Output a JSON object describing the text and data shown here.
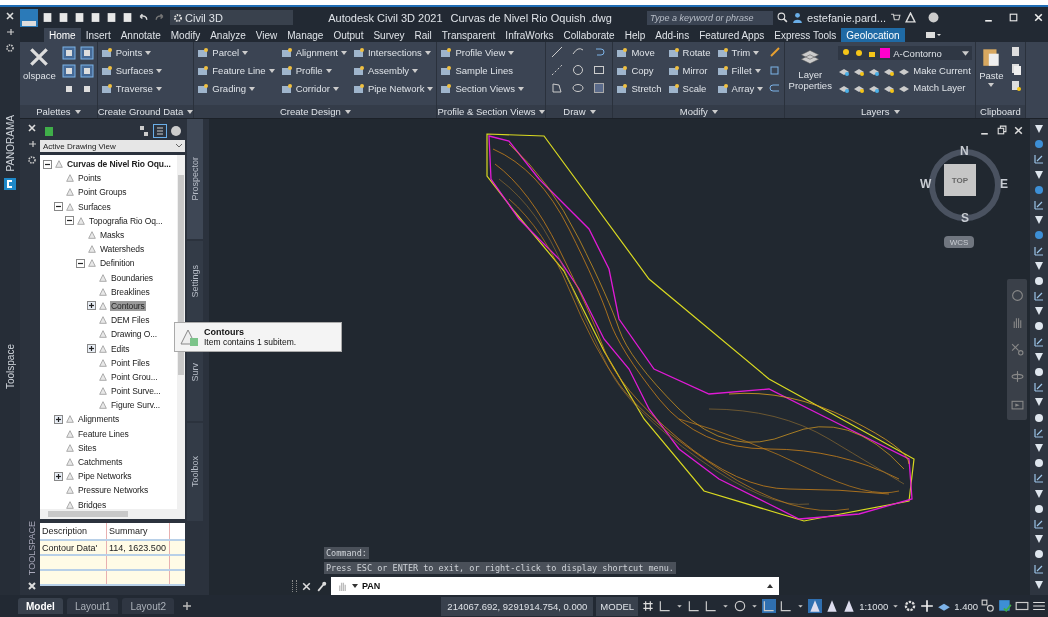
{
  "title_bar": {
    "workspace": "Civil 3D",
    "app_title": "Autodesk Civil 3D 2021",
    "file_name": "Curvas de Nivel Rio Oquish .dwg",
    "search_placeholder": "Type a keyword or phrase",
    "user": "estefanie.pard..."
  },
  "ribbon_tabs": [
    {
      "label": "Home",
      "selected": true,
      "kind": "standard"
    },
    {
      "label": "Insert",
      "selected": false,
      "kind": "standard"
    },
    {
      "label": "Annotate",
      "selected": false,
      "kind": "standard"
    },
    {
      "label": "Modify",
      "selected": false,
      "kind": "standard"
    },
    {
      "label": "Analyze",
      "selected": false,
      "kind": "standard"
    },
    {
      "label": "View",
      "selected": false,
      "kind": "standard"
    },
    {
      "label": "Manage",
      "selected": false,
      "kind": "standard"
    },
    {
      "label": "Output",
      "selected": false,
      "kind": "standard"
    },
    {
      "label": "Survey",
      "selected": false,
      "kind": "standard"
    },
    {
      "label": "Rail",
      "selected": false,
      "kind": "standard"
    },
    {
      "label": "Transparent",
      "selected": false,
      "kind": "standard"
    },
    {
      "label": "InfraWorks",
      "selected": false,
      "kind": "standard"
    },
    {
      "label": "Collaborate",
      "selected": false,
      "kind": "standard"
    },
    {
      "label": "Help",
      "selected": false,
      "kind": "standard"
    },
    {
      "label": "Add-ins",
      "selected": false,
      "kind": "standard"
    },
    {
      "label": "Featured Apps",
      "selected": false,
      "kind": "standard"
    },
    {
      "label": "Express Tools",
      "selected": false,
      "kind": "standard"
    },
    {
      "label": "Geolocation",
      "selected": false,
      "kind": "contextual"
    }
  ],
  "ribbon_panels": [
    {
      "title": "Palettes",
      "kind": "palettes",
      "big_button": "olspace"
    },
    {
      "title": "Create Ground Data",
      "kind": "tools",
      "columns": [
        [
          {
            "label": "Points",
            "dropdown": true
          },
          {
            "label": "Surfaces",
            "dropdown": true
          },
          {
            "label": "Traverse",
            "dropdown": true
          }
        ]
      ]
    },
    {
      "title": "Create Design",
      "kind": "tools",
      "columns": [
        [
          {
            "label": "Parcel",
            "dropdown": true
          },
          {
            "label": "Feature Line",
            "dropdown": true
          },
          {
            "label": "Grading",
            "dropdown": true
          }
        ],
        [
          {
            "label": "Alignment",
            "dropdown": true
          },
          {
            "label": "Profile",
            "dropdown": true
          },
          {
            "label": "Corridor",
            "dropdown": true
          }
        ],
        [
          {
            "label": "Intersections",
            "dropdown": true
          },
          {
            "label": "Assembly",
            "dropdown": true
          },
          {
            "label": "Pipe Network",
            "dropdown": true
          }
        ]
      ]
    },
    {
      "title": "Profile & Section Views",
      "kind": "tools",
      "columns": [
        [
          {
            "label": "Profile View",
            "dropdown": true
          },
          {
            "label": "Sample Lines",
            "dropdown": false
          },
          {
            "label": "Section Views",
            "dropdown": true
          }
        ]
      ]
    },
    {
      "title": "Draw",
      "kind": "draw"
    },
    {
      "title": "Modify",
      "kind": "tools",
      "columns": [
        [
          {
            "label": "Move",
            "dropdown": false
          },
          {
            "label": "Copy",
            "dropdown": false
          },
          {
            "label": "Stretch",
            "dropdown": false
          }
        ],
        [
          {
            "label": "Rotate",
            "dropdown": false
          },
          {
            "label": "Mirror",
            "dropdown": false
          },
          {
            "label": "Scale",
            "dropdown": false
          }
        ],
        [
          {
            "label": "Trim",
            "dropdown": true
          },
          {
            "label": "Fillet",
            "dropdown": true
          },
          {
            "label": "Array",
            "dropdown": true
          }
        ]
      ]
    },
    {
      "title": "Layers",
      "kind": "layers",
      "big_button": "Layer Properties",
      "layer": {
        "name": "A-Contorno",
        "color": "#ff00cc"
      },
      "actions": [
        "Make Current",
        "Match Layer"
      ]
    },
    {
      "title": "Clipboard",
      "kind": "clipboard",
      "big_button": "Paste"
    }
  ],
  "side_strip": {
    "top_label": "PANORAMA",
    "bottom_label": "Toolspace"
  },
  "toolspace": {
    "view": "Active Drawing View",
    "label": "TOOLSPACE",
    "tabs": [
      {
        "label": "Prospector",
        "selected": true
      },
      {
        "label": "Settings",
        "selected": false
      },
      {
        "label": "Surv",
        "selected": false
      },
      {
        "label": "Toolbox",
        "selected": false
      }
    ],
    "tree": [
      {
        "label": "Curvas de Nivel Rio Oqu...",
        "expanded": true,
        "selected": false,
        "children": [
          {
            "label": "Points",
            "selected": false
          },
          {
            "label": "Point Groups",
            "selected": false
          },
          {
            "label": "Surfaces",
            "expanded": true,
            "selected": false,
            "children": [
              {
                "label": "Topografia Rio Oq...",
                "expanded": true,
                "selected": false,
                "children": [
                  {
                    "label": "Masks",
                    "selected": false
                  },
                  {
                    "label": "Watersheds",
                    "selected": false
                  },
                  {
                    "label": "Definition",
                    "expanded": true,
                    "selected": false,
                    "children": [
                      {
                        "label": "Boundaries",
                        "selected": false
                      },
                      {
                        "label": "Breaklines",
                        "selected": false
                      },
                      {
                        "label": "Contours",
                        "expanded": false,
                        "selected": true
                      },
                      {
                        "label": "DEM Files",
                        "selected": false
                      },
                      {
                        "label": "Drawing O...",
                        "selected": false
                      },
                      {
                        "label": "Edits",
                        "expanded": false,
                        "selected": false
                      },
                      {
                        "label": "Point Files",
                        "selected": false
                      },
                      {
                        "label": "Point Grou...",
                        "selected": false
                      },
                      {
                        "label": "Point Surve...",
                        "selected": false
                      },
                      {
                        "label": "Figure Surv...",
                        "selected": false
                      }
                    ]
                  }
                ]
              }
            ]
          },
          {
            "label": "Alignments",
            "expanded": false,
            "selected": false
          },
          {
            "label": "Feature Lines",
            "selected": false
          },
          {
            "label": "Sites",
            "selected": false
          },
          {
            "label": "Catchments",
            "selected": false
          },
          {
            "label": "Pipe Networks",
            "expanded": false,
            "selected": false
          },
          {
            "label": "Pressure Networks",
            "selected": false
          },
          {
            "label": "Bridges",
            "selected": false
          }
        ]
      }
    ],
    "tooltip": {
      "title": "Contours",
      "text": "Item contains 1 subitem."
    },
    "list": {
      "columns": [
        "Description",
        "Summary"
      ],
      "rows": [
        [
          "Contour Data'",
          "114, 1623.500"
        ]
      ]
    }
  },
  "viewcube": {
    "north": "N",
    "south": "S",
    "east": "E",
    "west": "W",
    "face": "TOP",
    "ucs": "WCS"
  },
  "command_line": {
    "history": [
      "Command:",
      "Press ESC or ENTER to exit, or right-click to display shortcut menu."
    ],
    "value": "PAN"
  },
  "layout_tabs": [
    {
      "label": "Model",
      "selected": true
    },
    {
      "label": "Layout1",
      "selected": false
    },
    {
      "label": "Layout2",
      "selected": false
    }
  ],
  "status_bar": {
    "coordinates": "214067.692, 9291914.754, 0.000",
    "space": "MODEL",
    "scale": "1:1000",
    "lineweight": "1.400"
  }
}
